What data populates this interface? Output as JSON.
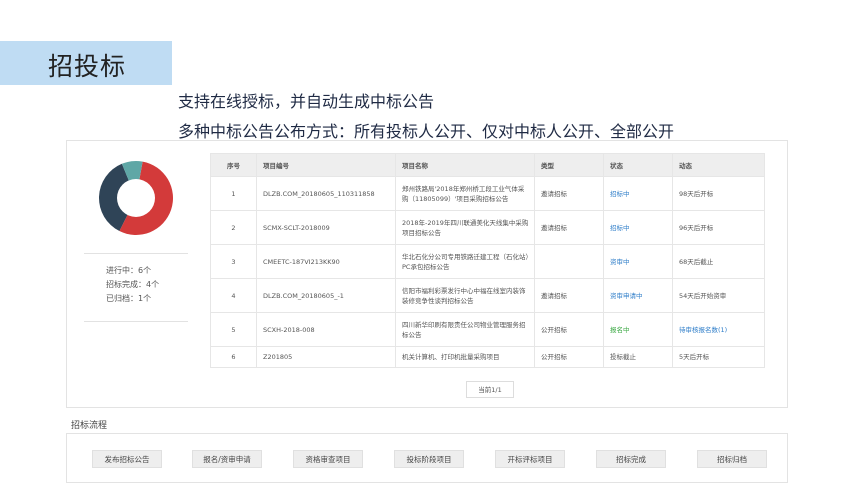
{
  "header": {
    "title": "招投标",
    "line1": "支持在线授标，并自动生成中标公告",
    "line2": "多种中标公告公布方式：所有投标人公开、仅对中标人公开、全部公开"
  },
  "colors": {
    "title_bg": "#bfdcf3",
    "donut_red": "#d33a3a",
    "donut_dark": "#2f4457",
    "donut_teal": "#5fa7a6",
    "status_blue": "#2f7ec9",
    "status_green": "#3aa843"
  },
  "stats": {
    "chart": {
      "type": "pie",
      "style": "donut",
      "segments": [
        {
          "label": "进行中",
          "value": 6
        },
        {
          "label": "招标完成",
          "value": 4
        },
        {
          "label": "已归档",
          "value": 1
        }
      ]
    },
    "ongoing": "进行中：6个",
    "completed": "招标完成：4个",
    "archived": "已归档：1个"
  },
  "table": {
    "headers": [
      "序号",
      "项目编号",
      "项目名称",
      "类型",
      "状态",
      "动态"
    ],
    "rows": [
      {
        "idx": "1",
        "code": "DLZB.COM_20180605_110311858",
        "name": "郑州铁路局'2018年郑州桥工段工业气体采购（11805099）'项目采购招标公告",
        "type": "邀请招标",
        "status": "招标中",
        "status_color": "blue",
        "dyn": "98天后开标",
        "dyn_link": false
      },
      {
        "idx": "2",
        "code": "SCMX-SCLT-2018009",
        "name": "2018年-2019年四川联通美化天线集中采购项目招标公告",
        "type": "邀请招标",
        "status": "招标中",
        "status_color": "blue",
        "dyn": "96天后开标",
        "dyn_link": false
      },
      {
        "idx": "3",
        "code": "CMEETC-187VI213KK90",
        "name": "华北石化分公司专用铁路迁建工程（石化站）PC承包招标公告",
        "type": "",
        "status": "资审中",
        "status_color": "blue",
        "dyn": "68天后截止",
        "dyn_link": false
      },
      {
        "idx": "4",
        "code": "DLZB.COM_20180605_-1",
        "name": "信阳市福利彩票发行中心中福在线室内装饰装修竞争性谈判招标公告",
        "type": "邀请招标",
        "status": "资审申请中",
        "status_color": "blue",
        "dyn": "54天后开始资审",
        "dyn_link": false
      },
      {
        "idx": "5",
        "code": "SCXH-2018-008",
        "name": "四川新华印刷有限责任公司物业管理服务招标公告",
        "type": "公开招标",
        "status": "报名中",
        "status_color": "green",
        "dyn": "待审核报名数(1)",
        "dyn_link": true
      },
      {
        "idx": "6",
        "code": "Z201805",
        "name": "机关计算机、打印机批量采购项目",
        "type": "公开招标",
        "status": "投标截止",
        "status_color": "none",
        "dyn": "5天后开标",
        "dyn_link": false
      }
    ]
  },
  "pager": {
    "label": "当前1/1"
  },
  "flow": {
    "label": "招标流程",
    "steps": [
      "发布招标公告",
      "报名/资审申请",
      "资格审查项目",
      "投标阶段项目",
      "开标评标项目",
      "招标完成",
      "招标归档"
    ]
  }
}
